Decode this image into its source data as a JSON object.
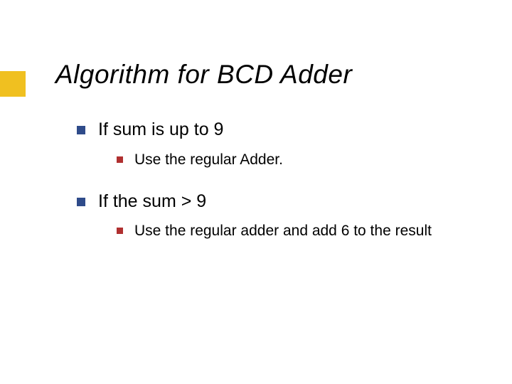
{
  "slide": {
    "title": "Algorithm for BCD Adder",
    "items": [
      {
        "text": "If sum is up to 9",
        "sub": [
          {
            "text": "Use the regular Adder."
          }
        ]
      },
      {
        "text": "If the sum > 9",
        "sub": [
          {
            "text": "Use the regular adder and add 6 to the result"
          }
        ]
      }
    ]
  }
}
